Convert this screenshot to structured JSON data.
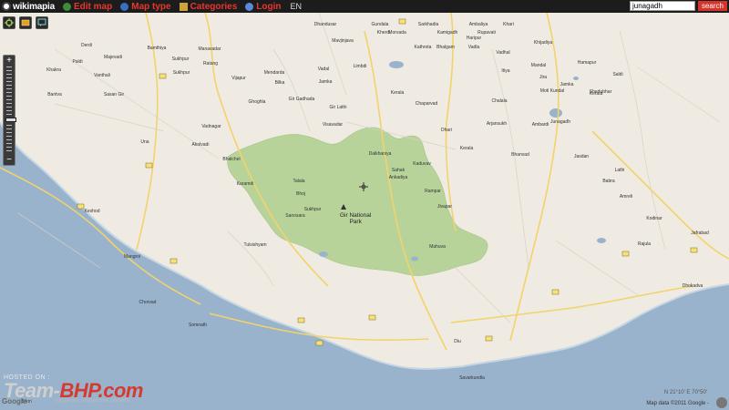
{
  "toolbar": {
    "brand": "wikimapia",
    "edit_map": "Edit map",
    "map_type": "Map type",
    "categories": "Categories",
    "login": "Login",
    "language": "EN",
    "search_value": "junagadh",
    "search_button": "search"
  },
  "map": {
    "park_name": [
      "Gir National",
      "Park"
    ],
    "places": [
      "Dhandusar",
      "Gundala",
      "Sarkhadia",
      "Ambaliya",
      "Kamigadh",
      "Kherdi",
      "Mavjinjava",
      "Morvada",
      "Rupavati",
      "Khari",
      "Haripur",
      "Khijadiya",
      "Kathrota",
      "Bhalgam",
      "Vadla",
      "Vadhal",
      "Derdi",
      "Bamthiya",
      "Majevadi",
      "Sukhpur",
      "Bilka",
      "Vadal",
      "Limbdi",
      "Ratang",
      "Mendarda",
      "Paldi",
      "Sukhpur",
      "Vijapur",
      "Jamka",
      "Khakra",
      "Gir Gadhada",
      "Gir Lathi",
      "Visavadar",
      "Ghoghla",
      "Vadnagar",
      "Akolvadi",
      "Bhalchel",
      "Karamdi",
      "Bhoj",
      "Sanosara",
      "Sukhpur",
      "Kerala",
      "Chaparvad",
      "Dhari",
      "Kaduvav",
      "Kerala",
      "Itiya",
      "Jira",
      "Moti Kundal",
      "Shedubhar",
      "Hamapur",
      "Saldi",
      "Mandal",
      "Jamka",
      "Kerala",
      "Sahak",
      "Ankadiya",
      "Rampar",
      "Jivapar",
      "Dalkhaniya",
      "Chalala",
      "Arjansukh",
      "Ambardi",
      "Bhanvad",
      "Jasdan",
      "Lathi",
      "Babra",
      "Amreli",
      "Kodinar",
      "Somnath",
      "Chorvad",
      "Mangrol",
      "Keshod",
      "Una",
      "Diu",
      "Savarkundla",
      "Junagadh",
      "Manavadar",
      "Vanthali",
      "Bantva",
      "Sasan Gir",
      "Talala",
      "Tulsishyam",
      "Mahuva",
      "Rajula",
      "Jafrabad",
      "Dhokadva"
    ],
    "zoom_in": "+",
    "zoom_out": "−"
  },
  "overlays": {
    "hosted_on": "HOSTED ON :",
    "logo_team": "Team-",
    "logo_bhp": "BHP.com",
    "tagline": "copyright respective owners",
    "google": "Google",
    "scale": "5 km",
    "copyright": "Map data ©2011 Google - ",
    "coords": "N 21°10' E 70°50'"
  }
}
